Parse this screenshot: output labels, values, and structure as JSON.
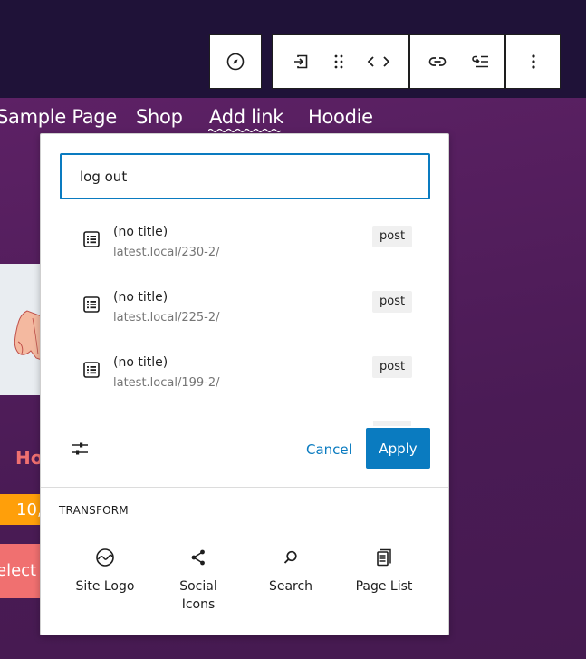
{
  "toolbar": {
    "groups": [
      {
        "icons": [
          "compass-icon"
        ]
      },
      {
        "icons": [
          "submenu-icon",
          "drag-handle-icon",
          "code-arrows-icon"
        ]
      },
      {
        "icons": [
          "link-icon",
          "add-submenu-icon"
        ]
      },
      {
        "icons": [
          "more-options-icon"
        ]
      }
    ]
  },
  "nav": {
    "items": [
      "Sample Page",
      "Shop",
      "Add link",
      "Hoodie"
    ]
  },
  "background": {
    "product_title_fragment": "Ho",
    "price_fragment": "10,(",
    "select_fragment": "elect"
  },
  "link_control": {
    "search": {
      "value": "log out"
    },
    "results": [
      {
        "title": "(no title)",
        "url": "latest.local/230-2/",
        "type": "post"
      },
      {
        "title": "(no title)",
        "url": "latest.local/225-2/",
        "type": "post"
      },
      {
        "title": "(no title)",
        "url": "latest.local/199-2/",
        "type": "post"
      }
    ],
    "cancel_label": "Cancel",
    "apply_label": "Apply",
    "settings_icon": "sliders-icon"
  },
  "transform": {
    "heading": "TRANSFORM",
    "items": [
      {
        "label": "Site Logo",
        "icon": "site-logo-icon"
      },
      {
        "label": "Social Icons",
        "icon": "share-icon"
      },
      {
        "label": "Search",
        "icon": "search-icon"
      },
      {
        "label": "Page List",
        "icon": "page-list-icon"
      }
    ]
  },
  "colors": {
    "accent": "#0a7bc0",
    "header_bg": "#1f1238",
    "page_bg": "#56205f",
    "coral": "#f07070",
    "orange": "#ff9f0a"
  }
}
